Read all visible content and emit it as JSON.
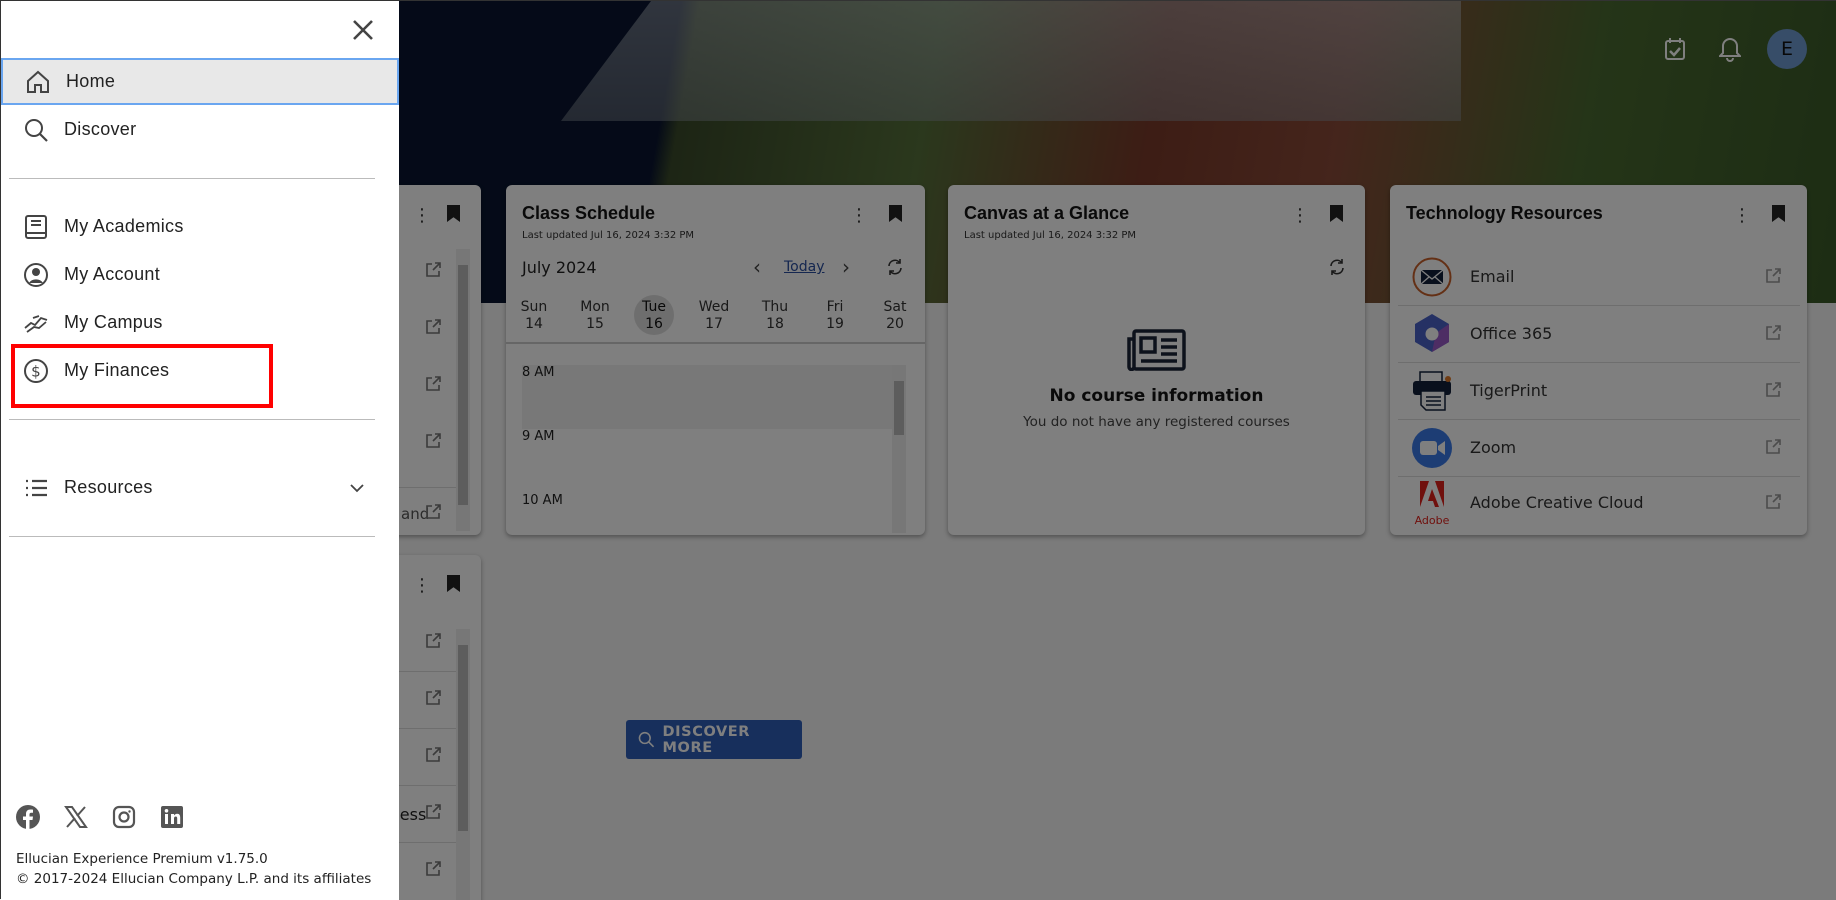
{
  "sidebar": {
    "close_icon": "close-icon",
    "items": [
      {
        "label": "Home",
        "icon": "home-icon",
        "selected": true
      },
      {
        "label": "Discover",
        "icon": "search-icon"
      },
      {
        "label": "My Academics",
        "icon": "book-icon"
      },
      {
        "label": "My Account",
        "icon": "account-circle-icon"
      },
      {
        "label": "My Campus",
        "icon": "handshake-icon"
      },
      {
        "label": "My Finances",
        "icon": "dollar-circle-icon",
        "highlighted": true
      },
      {
        "label": "Resources",
        "icon": "list-icon",
        "expandable": true
      }
    ],
    "social": [
      "facebook-icon",
      "x-icon",
      "instagram-icon",
      "linkedin-icon"
    ],
    "footer": {
      "version": "Ellucian Experience Premium v1.75.0",
      "copyright": "© 2017-2024 Ellucian Company L.P. and its affiliates"
    }
  },
  "header": {
    "icons": [
      "calendar-check-icon",
      "bell-icon"
    ],
    "avatar_initial": "E",
    "avatar_color": "#6f9ad0"
  },
  "cards": {
    "partial_top": {
      "fragment": "and"
    },
    "partial_bottom": {
      "fragment": "cess"
    },
    "class_schedule": {
      "title": "Class Schedule",
      "updated": "Last updated Jul 16, 2024 3:32 PM",
      "month": "July 2024",
      "today_label": "Today",
      "days": [
        {
          "name": "Sun",
          "num": "14"
        },
        {
          "name": "Mon",
          "num": "15"
        },
        {
          "name": "Tue",
          "num": "16",
          "selected": true
        },
        {
          "name": "Wed",
          "num": "17"
        },
        {
          "name": "Thu",
          "num": "18"
        },
        {
          "name": "Fri",
          "num": "19"
        },
        {
          "name": "Sat",
          "num": "20"
        }
      ],
      "hours": [
        "8 AM",
        "9 AM",
        "10 AM"
      ]
    },
    "canvas": {
      "title": "Canvas at a Glance",
      "updated": "Last updated Jul 16, 2024 3:32 PM",
      "empty_title": "No course information",
      "empty_text": "You do not have any registered courses"
    },
    "tech": {
      "title": "Technology Resources",
      "items": [
        {
          "label": "Email",
          "icon": "email-icon"
        },
        {
          "label": "Office 365",
          "icon": "office-365-icon"
        },
        {
          "label": "TigerPrint",
          "icon": "printer-icon"
        },
        {
          "label": "Zoom",
          "icon": "zoom-icon"
        },
        {
          "label": "Adobe Creative Cloud",
          "icon": "adobe-icon",
          "logo_text": "Adobe"
        }
      ]
    }
  },
  "discover_more": {
    "label": "DISCOVER MORE",
    "color": "#2f5fb8"
  },
  "colors": {
    "highlight_box": "#ff0000",
    "selected_border": "#6aa6f0"
  }
}
